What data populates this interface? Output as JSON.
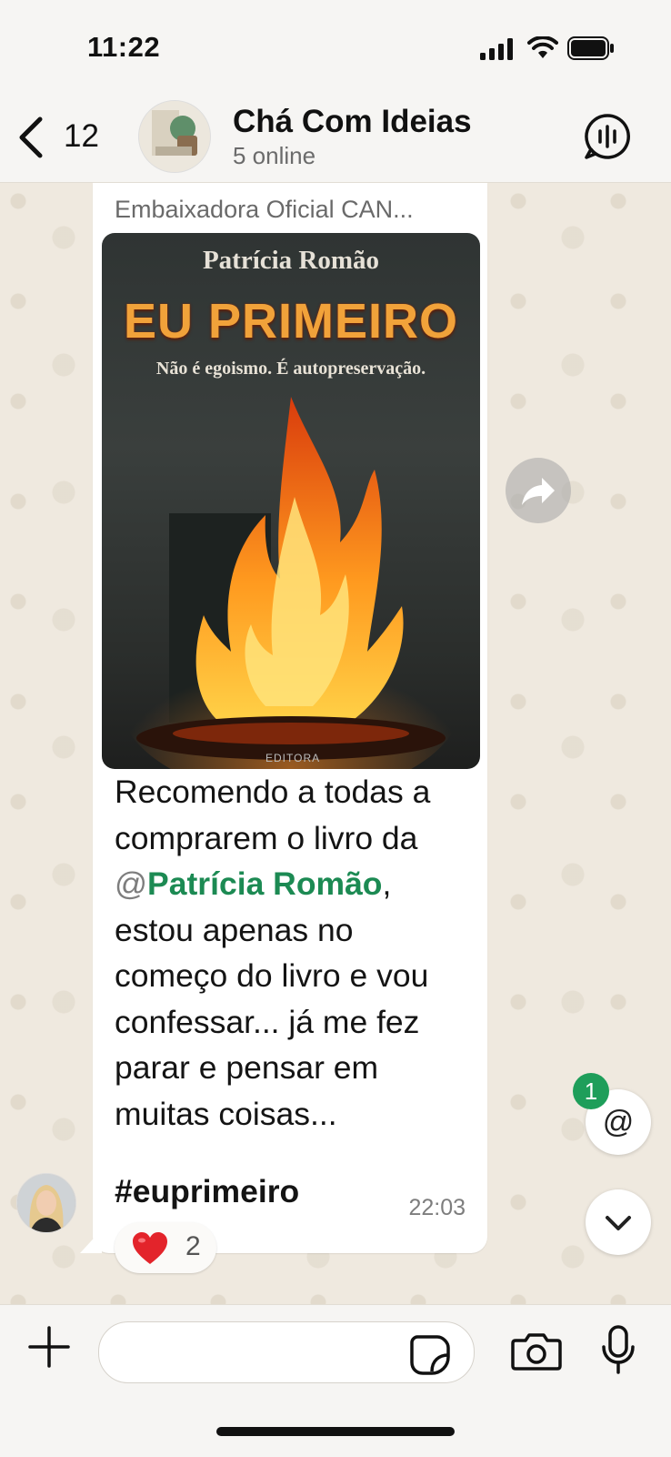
{
  "status_bar": {
    "time": "11:22"
  },
  "header": {
    "back_count": "12",
    "title": "Chá Com Ideias",
    "subtitle": "5 online"
  },
  "message": {
    "sender": "Embaixadora Oficial CAN...",
    "book": {
      "author": "Patrícia Romão",
      "title": "EU PRIMEIRO",
      "subtitle": "Não é egoismo. É autopreservação.",
      "publisher": "EDITORA"
    },
    "text_lines": [
      "Recomendo a todas a",
      "comprarem o livro da",
      "@",
      "Patrícia Romão",
      ",",
      "estou apenas no",
      "começo do livro e vou",
      "confessar... já me fez",
      "parar e pensar em",
      "muitas coisas..."
    ],
    "hashtag": "#euprimeiro",
    "time": "22:03",
    "reaction": {
      "emoji": "❤️",
      "count": "2"
    }
  },
  "mention_badge": "1",
  "mention_symbol": "@",
  "composer": {
    "placeholder": ""
  },
  "colors": {
    "mention": "#1c8a53",
    "badge": "#1e9e5a",
    "chat_bg": "#efe9df"
  }
}
